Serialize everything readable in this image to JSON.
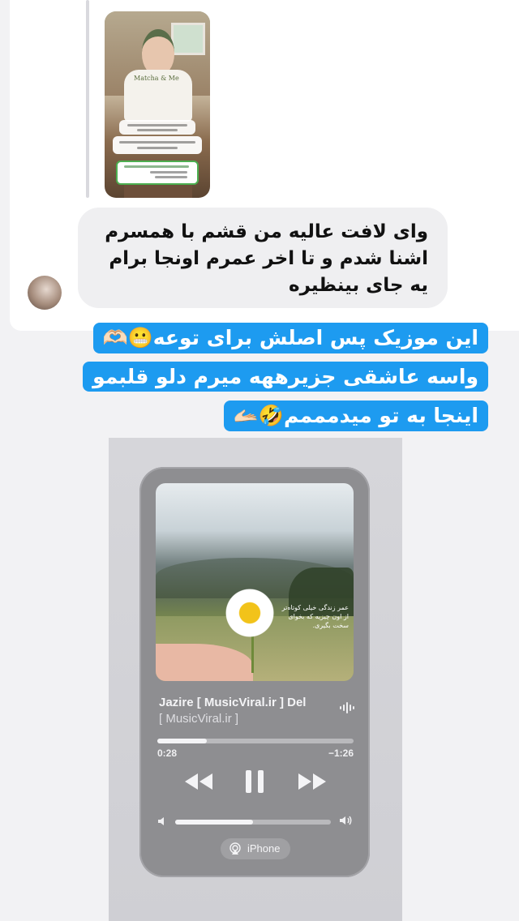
{
  "colors": {
    "caption_bg": "#1d9bf0",
    "caption_text": "#ffffff",
    "bubble_bg": "#efeff1",
    "player_bg": "#8e8e91"
  },
  "story_reply": {
    "thumbnail_shirt_text": "Matcha & Me",
    "thumbnail_type": "instagram-story-preview"
  },
  "message": {
    "text": "وای لافت عالیه من قشم با همسرم اشنا شدم و تا اخر عمرم اونجا برام یه جای بینظیره",
    "avatar_icon": "user-avatar"
  },
  "caption": {
    "line1": "این موزیک پس اصلش برای توعه😬🫶🏻",
    "line2": "واسه عاشقی جزیرههه میرم دلو قلبمو",
    "line3": "اینجا به تو میدمممم🤣🫴🏻"
  },
  "player": {
    "title": "Jazire [ MusicViral.ir ]     Del",
    "artist": "[ MusicViral.ir ]",
    "artwork_caption": "عمر زندگی خیلی کوتاه‌تر از اون چیزیه که بخوای سخت بگیری.",
    "elapsed": "0:28",
    "remaining": "−1:26",
    "progress": 0.25,
    "volume": 0.5,
    "output_device": "iPhone",
    "controls": {
      "rewind_icon": "rewind-icon",
      "pause_icon": "pause-icon",
      "forward_icon": "fast-forward-icon",
      "airplay_icon": "airplay-icon"
    }
  }
}
